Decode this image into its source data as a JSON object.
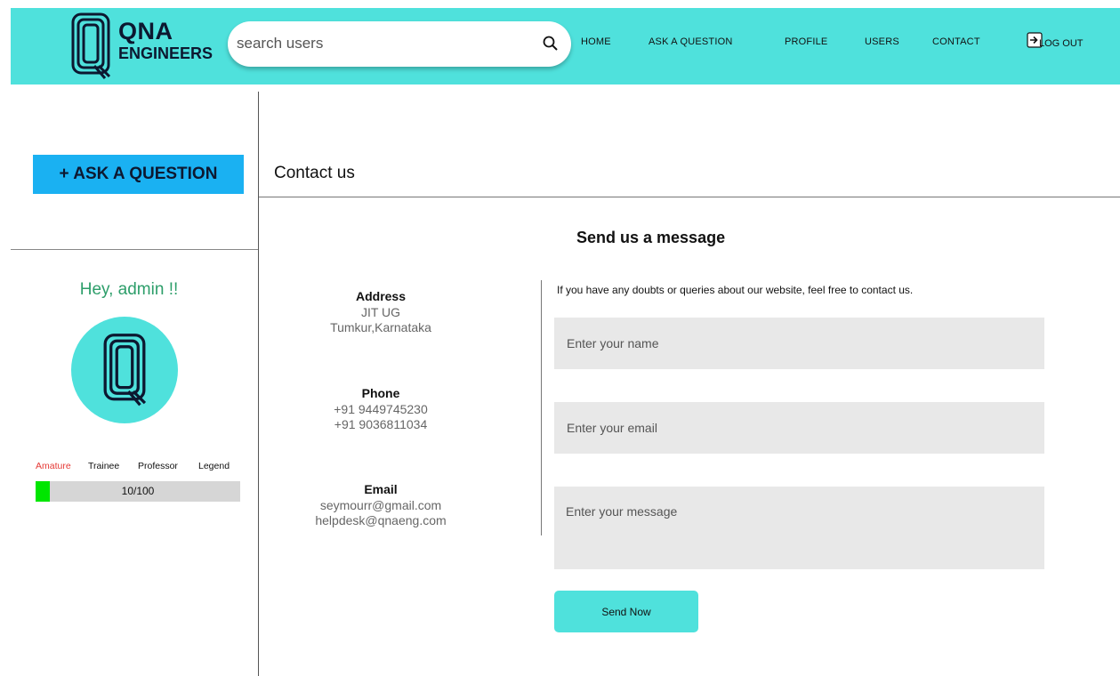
{
  "header": {
    "logo": {
      "line1": "QNA",
      "line2": "ENGINEERS"
    },
    "search": {
      "placeholder": "search users",
      "icon": "search-icon"
    },
    "nav": [
      {
        "label": "HOME"
      },
      {
        "label": "ASK A QUESTION"
      },
      {
        "label": "PROFILE"
      },
      {
        "label": "USERS"
      },
      {
        "label": "CONTACT"
      }
    ],
    "logout": {
      "label": "LOG OUT",
      "icon": "logout-icon"
    }
  },
  "sidebar": {
    "ask_button": "+ ASK A QUESTION",
    "greeting": "Hey, admin !!",
    "ranks": [
      {
        "label": "Amature",
        "active": true
      },
      {
        "label": "Trainee",
        "active": false
      },
      {
        "label": "Professor",
        "active": false
      },
      {
        "label": "Legend",
        "active": false
      }
    ],
    "progress": {
      "label": "10/100",
      "value": 10,
      "max": 100
    }
  },
  "main": {
    "page_title": "Contact us",
    "section_title": "Send us a message",
    "address": {
      "heading": "Address",
      "lines": [
        "JIT UG",
        "Tumkur,Karnataka"
      ]
    },
    "phone": {
      "heading": "Phone",
      "lines": [
        "+91 9449745230",
        "+91 9036811034"
      ]
    },
    "email": {
      "heading": "Email",
      "lines": [
        "seymourr@gmail.com",
        "helpdesk@qnaeng.com"
      ]
    },
    "intro": "If you have any doubts or queries about our website, feel free to contact us.",
    "form": {
      "name_placeholder": "Enter your name",
      "email_placeholder": "Enter your email",
      "message_placeholder": "Enter your message",
      "submit_label": "Send Now"
    }
  },
  "colors": {
    "header_bg": "#4fe1dc",
    "ask_button_bg": "#1ab1f2",
    "greeting": "#2d9e6a",
    "rank_active": "#e53935",
    "progress_fill": "#00e600",
    "field_bg": "#e8e8e8"
  }
}
